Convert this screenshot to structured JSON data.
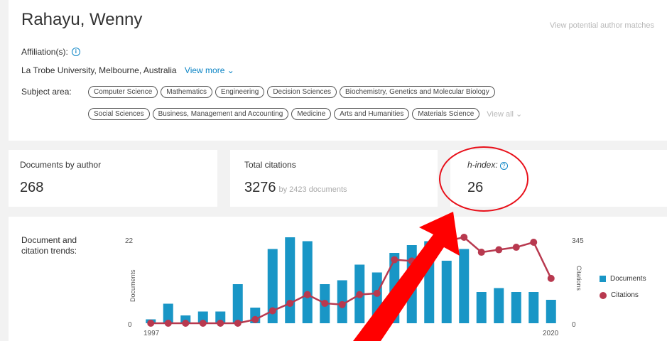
{
  "author": {
    "name": "Rahayu, Wenny",
    "potential_matches": "View potential author matches",
    "affiliation_label": "Affiliation(s):",
    "affiliation": "La Trobe University, Melbourne, Australia",
    "view_more": "View more",
    "subject_label": "Subject area:",
    "subjects_row1": [
      "Computer Science",
      "Mathematics",
      "Engineering",
      "Decision Sciences",
      "Biochemistry, Genetics and Molecular Biology"
    ],
    "subjects_row2": [
      "Social Sciences",
      "Business, Management and Accounting",
      "Medicine",
      "Arts and Humanities",
      "Materials Science"
    ],
    "view_all": "View all"
  },
  "metrics": {
    "documents_label": "Documents by author",
    "documents_value": "268",
    "citations_label": "Total citations",
    "citations_value": "3276",
    "citations_sub": "by 2423 documents",
    "hindex_label": "h-index:",
    "hindex_value": "26"
  },
  "trends": {
    "label": "Document and citation trends:",
    "legend_documents": "Documents",
    "legend_citations": "Citations"
  },
  "colors": {
    "bar": "#1996c6",
    "line": "#b8394f",
    "link": "#0b84c5",
    "annotation": "#e8101a"
  },
  "chart_data": {
    "type": "bar",
    "x": [
      1997,
      1998,
      1999,
      2000,
      2001,
      2002,
      2003,
      2004,
      2005,
      2006,
      2007,
      2008,
      2009,
      2010,
      2011,
      2012,
      2013,
      2014,
      2015,
      2016,
      2017,
      2018,
      2019,
      2020
    ],
    "x_tick_labels": [
      "1997",
      "2020"
    ],
    "series": [
      {
        "name": "Documents",
        "axis": "left",
        "kind": "bar",
        "values": [
          1,
          5,
          2,
          3,
          3,
          10,
          4,
          19,
          22,
          21,
          10,
          11,
          15,
          13,
          18,
          20,
          21,
          16,
          19,
          8,
          9,
          8,
          8,
          6
        ]
      },
      {
        "name": "Citations",
        "axis": "right",
        "kind": "line",
        "values": [
          0,
          0,
          0,
          0,
          0,
          0,
          15,
          50,
          80,
          115,
          80,
          75,
          115,
          120,
          255,
          250,
          275,
          330,
          345,
          285,
          295,
          305,
          325,
          180
        ]
      }
    ],
    "left_axis": {
      "label": "Documents",
      "range": [
        0,
        22
      ],
      "ticks": [
        "0",
        "22"
      ]
    },
    "right_axis": {
      "label": "Citations",
      "range": [
        0,
        345
      ],
      "ticks": [
        "0",
        "345"
      ]
    },
    "legend_position": "right"
  }
}
